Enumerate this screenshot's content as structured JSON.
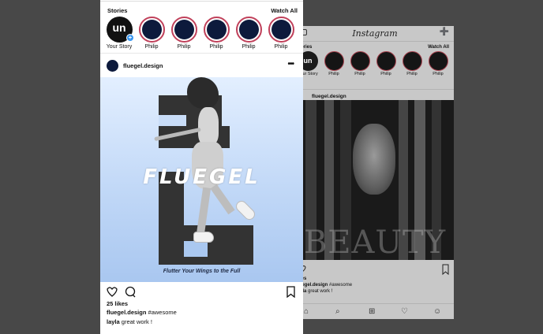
{
  "front": {
    "stories_label": "Stories",
    "watch_all": "Watch All",
    "your_story_initials": "un",
    "stories": [
      {
        "name": "Your Story"
      },
      {
        "name": "Philip"
      },
      {
        "name": "Philip"
      },
      {
        "name": "Philip"
      },
      {
        "name": "Philip"
      },
      {
        "name": "Philip"
      }
    ],
    "post": {
      "username": "fluegel.design",
      "more": "•••",
      "brand": "FLUEGEL",
      "tagline": "Flutter Your Wings to the Full",
      "likes": "25 likes",
      "caption_user": "fluegel.design",
      "caption_text": "#awesome",
      "comment_user": "layla",
      "comment_text": "great work !"
    }
  },
  "back": {
    "logo": "Instagram",
    "stories_label": "Stories",
    "watch_all": "Watch All",
    "your_story_initials": "un",
    "stories": [
      {
        "name": "Your Story"
      },
      {
        "name": "Philip"
      },
      {
        "name": "Philip"
      },
      {
        "name": "Philip"
      },
      {
        "name": "Philip"
      },
      {
        "name": "Philip"
      }
    ],
    "post": {
      "username": "fluegel.design",
      "image_text": "BEAUTY",
      "likes": "likes",
      "caption_user": "fluegel.design",
      "caption_text": "#awesome",
      "comment_user": "layla",
      "comment_text": "great work !"
    }
  },
  "colors": {
    "background": "#484848",
    "story_ring": "#c0405a",
    "avatar_fill": "#0d1a3c",
    "plus_badge": "#3897f0"
  }
}
